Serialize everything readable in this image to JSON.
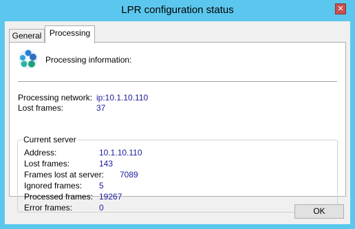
{
  "window": {
    "title": "LPR configuration status",
    "close_glyph": "✕"
  },
  "tabs": [
    {
      "label": "General",
      "selected": false
    },
    {
      "label": "Processing",
      "selected": true
    }
  ],
  "processing": {
    "header": "Processing information:",
    "icon": "globe-network-icon",
    "network_label": "Processing network:",
    "network_value": "ip:10.1.10.110",
    "lost_frames_label": "Lost frames:",
    "lost_frames_value": "37"
  },
  "current_server": {
    "title": "Current server",
    "rows": [
      {
        "label": "Address:",
        "value": "10.1.10.110"
      },
      {
        "label": "Lost frames:",
        "value": "143"
      },
      {
        "label": "Frames lost at server:",
        "value": "7089"
      },
      {
        "label": "Ignored frames:",
        "value": "5"
      },
      {
        "label": "Processed frames:",
        "value": "19267"
      },
      {
        "label": "Error frames:",
        "value": "0"
      }
    ]
  },
  "buttons": {
    "ok_label": "OK"
  },
  "colors": {
    "title_bar": "#5cc7ee",
    "value_text": "#1a1a9c",
    "close_button": "#c75050"
  }
}
